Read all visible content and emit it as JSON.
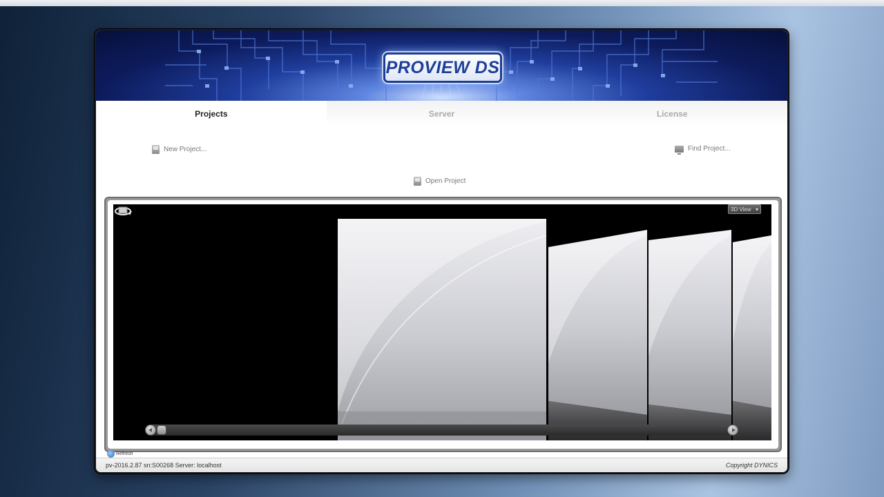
{
  "app": {
    "logo_text": "PROVIEW DS"
  },
  "tabs": [
    {
      "label": "Projects",
      "active": true
    },
    {
      "label": "Server",
      "active": false
    },
    {
      "label": "License",
      "active": false
    }
  ],
  "actions": {
    "new_project": "New Project...",
    "find_project": "Find Project...",
    "open_project": "Open Project"
  },
  "viewer": {
    "view_mode": "3D View"
  },
  "refresh_label": "Refresh",
  "status": {
    "left": "pv-2016.2.87 sn:S00268 Server: localhost",
    "right": "Copyright DYNICS"
  },
  "colors": {
    "brand_blue": "#1c3f9a",
    "banner_dark": "#06103a"
  }
}
